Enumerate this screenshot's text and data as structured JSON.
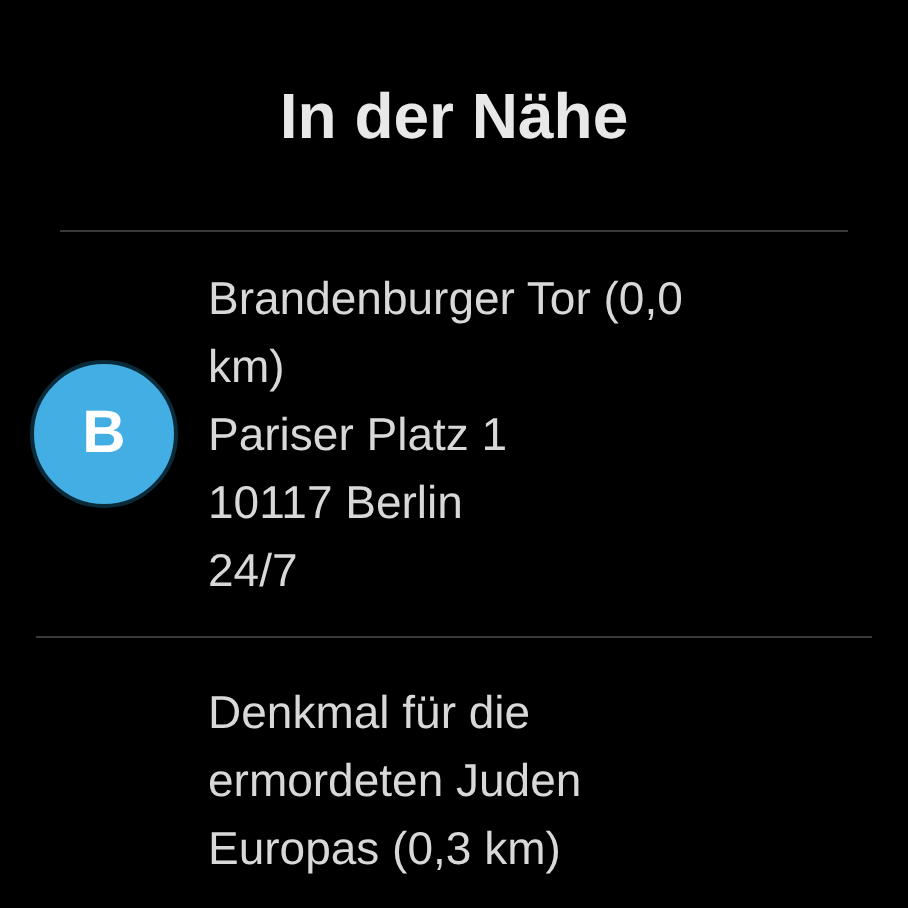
{
  "title": "In der Nähe",
  "places": [
    {
      "initial": "B",
      "color": "#42aee3",
      "name": "Brandenburger Tor (0,0 km)",
      "lines": [
        "Pariser Platz 1",
        "10117 Berlin",
        "24/7"
      ]
    },
    {
      "name": "Denkmal für die ermordeten Juden Europas (0,3 km)"
    }
  ]
}
